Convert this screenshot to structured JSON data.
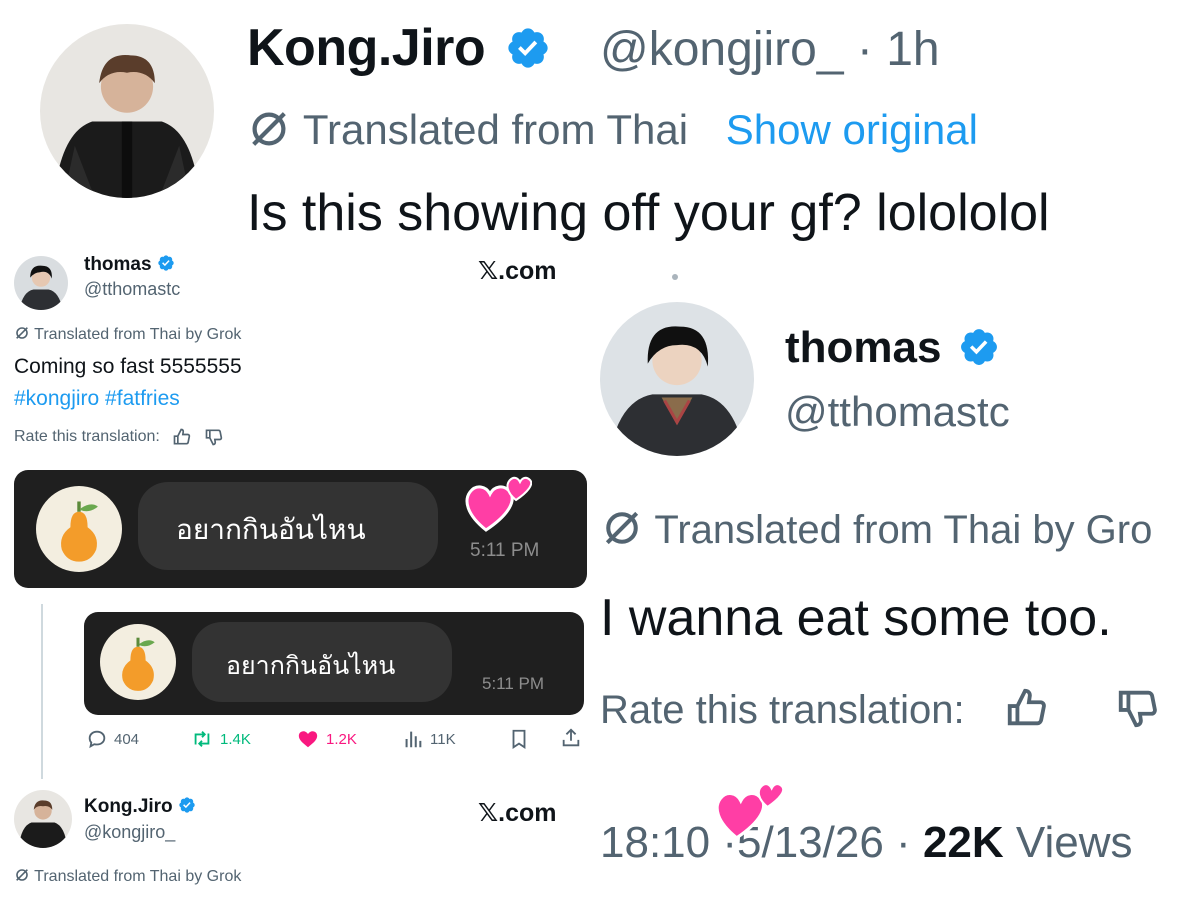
{
  "top_post": {
    "name": "Kong.Jiro",
    "handle": "@kongjiro_",
    "separator": "·",
    "age": "1h",
    "translated_label": "Translated from Thai",
    "show_original": "Show original",
    "text": "Is this showing off your gf? lolololol"
  },
  "left_post": {
    "name": "thomas",
    "handle": "@tthomastc",
    "site": "𝕏.com",
    "translated_label": "Translated from Thai by Grok",
    "text": "Coming so fast 5555555",
    "hashtags": "#kongjiro #fatfries",
    "rate_label": "Rate this translation:",
    "chat": {
      "message": "อยากกินอันไหน",
      "time": "5:11 PM"
    },
    "actions": {
      "replies": "404",
      "reposts": "1.4K",
      "likes": "1.2K",
      "views": "11K"
    }
  },
  "bottom_post": {
    "name": "Kong.Jiro",
    "handle": "@kongjiro_",
    "site": "𝕏.com",
    "translated_label": "Translated from Thai by Grok"
  },
  "right_post": {
    "name": "thomas",
    "handle": "@tthomastc",
    "translated_label": "Translated from Thai by Gro",
    "text": "I wanna eat some too.",
    "rate_label": "Rate this translation:",
    "time": "18:10",
    "date": "5/13/26",
    "views_count": "22K",
    "views_label": "Views",
    "separator": "·"
  },
  "colors": {
    "accent_blue": "#1d9bf0",
    "repost_green": "#00ba7c",
    "like_pink": "#f91880",
    "text_gray": "#536471"
  },
  "icons": [
    "verified-badge-icon",
    "translate-icon",
    "thumbs-up-icon",
    "thumbs-down-icon",
    "reply-icon",
    "repost-icon",
    "heart-icon",
    "views-icon",
    "bookmark-icon",
    "share-icon",
    "pear-avatar-icon",
    "heart-sticker-icon"
  ]
}
